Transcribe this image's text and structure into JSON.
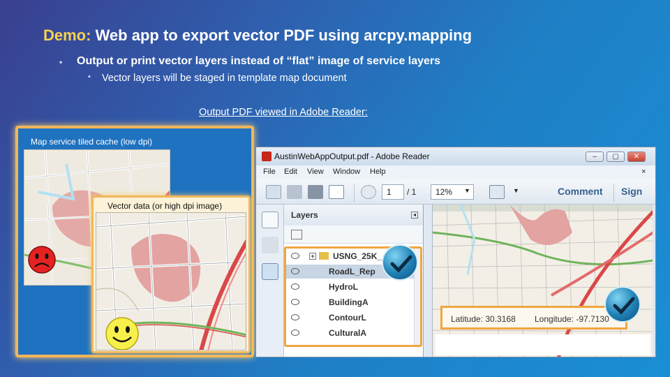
{
  "slide": {
    "title_prefix": "Demo:",
    "title_rest": " Web app to export vector PDF using arcpy.mapping",
    "bullet1": "Output or print vector layers instead of “flat” image of service layers",
    "bullet2": "Vector layers will be staged in template map document",
    "caption": "Output PDF viewed in Adobe Reader:"
  },
  "left_panel": {
    "outer_label": "Map service tiled cache (low dpi)",
    "inner_label": "Vector data (or high dpi image)",
    "sad_face": "sad-face-icon",
    "happy_face": "happy-face-icon"
  },
  "adobe": {
    "title": "AustinWebAppOutput.pdf - Adobe Reader",
    "menu": [
      "File",
      "Edit",
      "View",
      "Window",
      "Help"
    ],
    "page_current": "1",
    "page_total": "/ 1",
    "zoom": "12%",
    "comment": "Comment",
    "sign": "Sign",
    "layers_title": "Layers",
    "layers": [
      {
        "name": "USNG_25K_",
        "group": true
      },
      {
        "name": "RoadL_Rep",
        "selected": true
      },
      {
        "name": "HydroL"
      },
      {
        "name": "BuildingA"
      },
      {
        "name": "ContourL"
      },
      {
        "name": "CulturalA"
      }
    ],
    "latitude": "Latitude: 30.3168",
    "longitude": "Longitude: -97.7130"
  },
  "colors": {
    "accent_yellow": "#f5d250",
    "highlight_orange": "#f0a640",
    "background_blue": "#1f7fc6"
  }
}
